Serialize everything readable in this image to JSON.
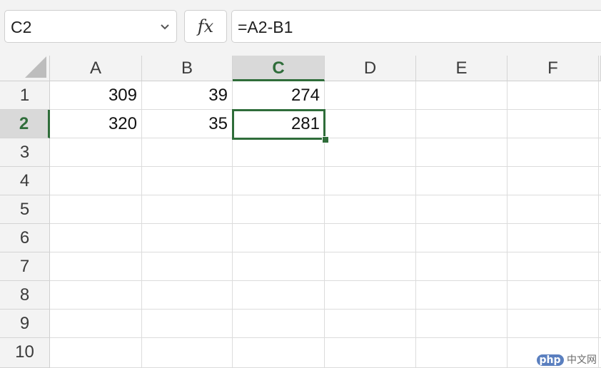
{
  "formula_bar": {
    "name_box": "C2",
    "fx_label": "fx",
    "formula": "=A2-B1"
  },
  "columns": [
    "A",
    "B",
    "C",
    "D",
    "E",
    "F"
  ],
  "rows": [
    "1",
    "2",
    "3",
    "4",
    "5",
    "6",
    "7",
    "8",
    "9",
    "10"
  ],
  "cells": {
    "A1": "309",
    "B1": "39",
    "C1": "274",
    "A2": "320",
    "B2": "35",
    "C2": "281"
  },
  "selection": {
    "active_cell": "C2",
    "active_column": "C",
    "active_row": "2"
  },
  "watermark": {
    "badge": "php",
    "text": "中文网"
  },
  "colors": {
    "accent": "#2f6d3a",
    "header_bg": "#f3f3f3",
    "active_header_bg": "#d9d9d9"
  }
}
